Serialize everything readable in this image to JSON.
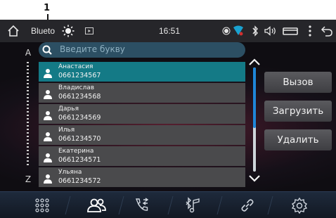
{
  "callout": {
    "label": "1"
  },
  "status_bar": {
    "source": "Blueto",
    "time": "16:51"
  },
  "alphabet": {
    "first": "A",
    "last": "Z"
  },
  "search": {
    "placeholder": "Введите букву"
  },
  "contacts": [
    {
      "name": "Анастасия",
      "phone": "0661234567",
      "selected": true
    },
    {
      "name": "Владислав",
      "phone": "0661234568",
      "selected": false
    },
    {
      "name": "Дарья",
      "phone": "0661234569",
      "selected": false
    },
    {
      "name": "Илья",
      "phone": "0661234570",
      "selected": false
    },
    {
      "name": "Екатерина",
      "phone": "0661234571",
      "selected": false
    },
    {
      "name": "Ульяна",
      "phone": "0661234572",
      "selected": false
    }
  ],
  "actions": {
    "call": "Вызов",
    "download": "Загрузить",
    "delete": "Удалить"
  },
  "colors": {
    "selected_row": "#147a86",
    "row": "#4a4a4c",
    "accent_blue": "#1f86d8",
    "search_bg": "#2c4f63"
  },
  "nav": [
    "apps-icon",
    "contacts-icon",
    "recent-calls-icon",
    "bluetooth-music-icon",
    "link-icon",
    "settings-icon"
  ],
  "active_nav": "contacts-icon"
}
